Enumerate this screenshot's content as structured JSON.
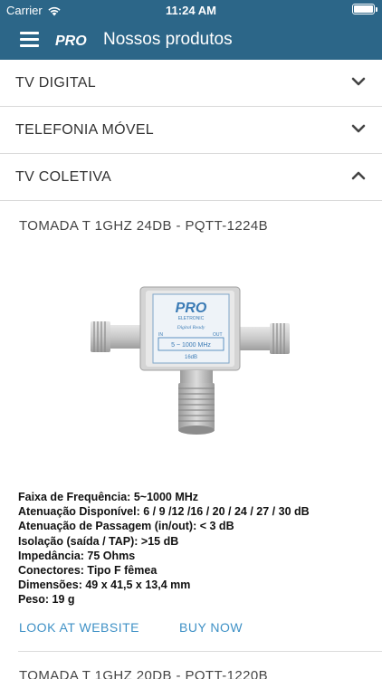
{
  "status_bar": {
    "carrier": "Carrier",
    "time": "11:24 AM"
  },
  "nav": {
    "logo_text": "PRO",
    "title": "Nossos produtos"
  },
  "sections": [
    {
      "label": "TV DIGITAL",
      "expanded": false
    },
    {
      "label": "TELEFONIA MÓVEL",
      "expanded": false
    },
    {
      "label": "TV COLETIVA",
      "expanded": true
    }
  ],
  "product": {
    "title": "TOMADA T 1GHZ 24DB - PQTT-1224B",
    "image_labels": {
      "brand": "PRO",
      "sub": "ELETRONIC",
      "digital": "Digital Ready",
      "in": "IN",
      "out": "OUT",
      "range": "5 ~ 1000 MHz",
      "db": "16dB"
    },
    "specs": [
      "Faixa de Frequência: 5~1000 MHz",
      "Atenuação Disponível: 6 / 9 /12 /16 / 20 / 24 / 27 / 30 dB",
      "Atenuação de Passagem (in/out): < 3 dB",
      "Isolação (saída / TAP): >15 dB",
      "Impedância: 75 Ohms",
      "Conectores: Tipo F fêmea",
      "Dimensões: 49 x 41,5 x 13,4 mm",
      "Peso: 19 g"
    ],
    "website_label": "LOOK AT WEBSITE",
    "buy_label": "BUY NOW"
  },
  "next_product": {
    "title": "TOMADA T 1GHZ 20DB - PQTT-1220B"
  },
  "colors": {
    "navbar": "#2c6688",
    "link": "#3f91c6"
  }
}
